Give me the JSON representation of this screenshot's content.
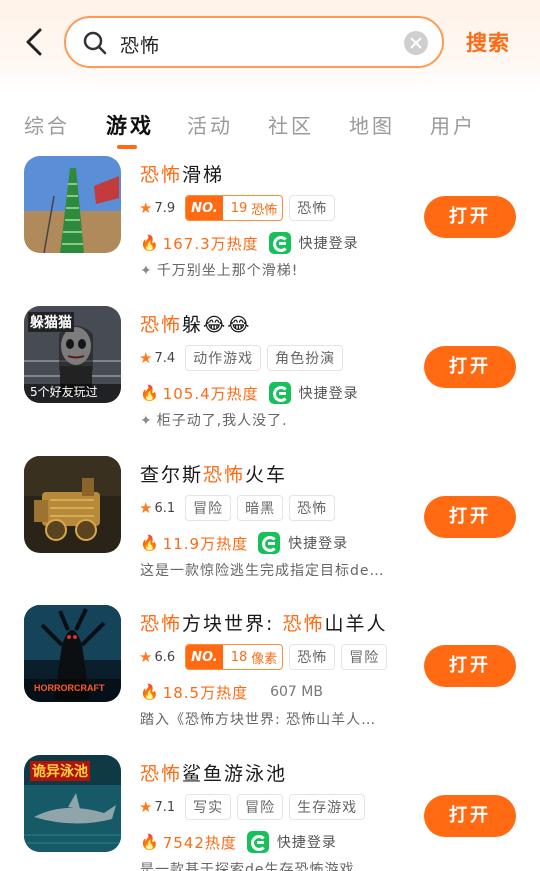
{
  "search": {
    "query": "恐怖",
    "button": "搜索"
  },
  "tabs": [
    {
      "label": "综合"
    },
    {
      "label": "游戏"
    },
    {
      "label": "活动"
    },
    {
      "label": "社区"
    },
    {
      "label": "地图"
    },
    {
      "label": "用户"
    }
  ],
  "active_tab": "游戏",
  "colors": {
    "accent": "#ff6a13",
    "google_green": "#16c15a"
  },
  "items": [
    {
      "title_hl": "恐怖",
      "title_rest": "滑梯",
      "rating": "7.9",
      "rank": {
        "no": "NO.",
        "num": "19",
        "label": "恐怖"
      },
      "tags": [
        "恐怖"
      ],
      "heat": "167.3万热度",
      "quick_login": "快捷登录",
      "desc": "千万别坐上那个滑梯!",
      "button": "打开",
      "icon": "slide-game-icon"
    },
    {
      "title_hl": "恐怖",
      "title_rest": "躲😂😂",
      "rating": "7.4",
      "tags": [
        "动作游戏",
        "角色扮演"
      ],
      "heat": "105.4万热度",
      "quick_login": "快捷登录",
      "desc": "柜子动了,我人没了.",
      "icon_caption_top": "躲猫猫",
      "icon_caption_bottom": "5个好友玩过",
      "button": "打开",
      "icon": "hide-seek-game-icon"
    },
    {
      "title_pre": "查尔斯",
      "title_hl": "恐怖",
      "title_rest": "火车",
      "rating": "6.1",
      "tags": [
        "冒险",
        "暗黑",
        "恐怖"
      ],
      "heat": "11.9万热度",
      "quick_login": "快捷登录",
      "desc": "这是一款惊险逃生完成指定目标de…",
      "button": "打开",
      "icon": "train-game-icon"
    },
    {
      "title_hl": "恐怖",
      "title_mid": "方块世界: ",
      "title_hl2": "恐怖",
      "title_rest": "山羊人",
      "rating": "6.6",
      "rank": {
        "no": "NO.",
        "num": "18",
        "label": "像素"
      },
      "tags": [
        "恐怖",
        "冒险"
      ],
      "heat": "18.5万热度",
      "size": "607 MB",
      "desc": "踏入《恐怖方块世界: 恐怖山羊人…",
      "icon_caption_bottom": "HORRORCRAFT",
      "button": "打开",
      "icon": "horrorcraft-game-icon"
    },
    {
      "title_hl": "恐怖",
      "title_rest": "鲨鱼游泳池",
      "rating": "7.1",
      "tags": [
        "写实",
        "冒险",
        "生存游戏"
      ],
      "heat": "7542热度",
      "quick_login": "快捷登录",
      "desc": "是一款基于探索de生存恐怖游戏, …",
      "icon_caption_top": "诡异泳池",
      "button": "打开",
      "icon": "shark-pool-game-icon"
    }
  ]
}
